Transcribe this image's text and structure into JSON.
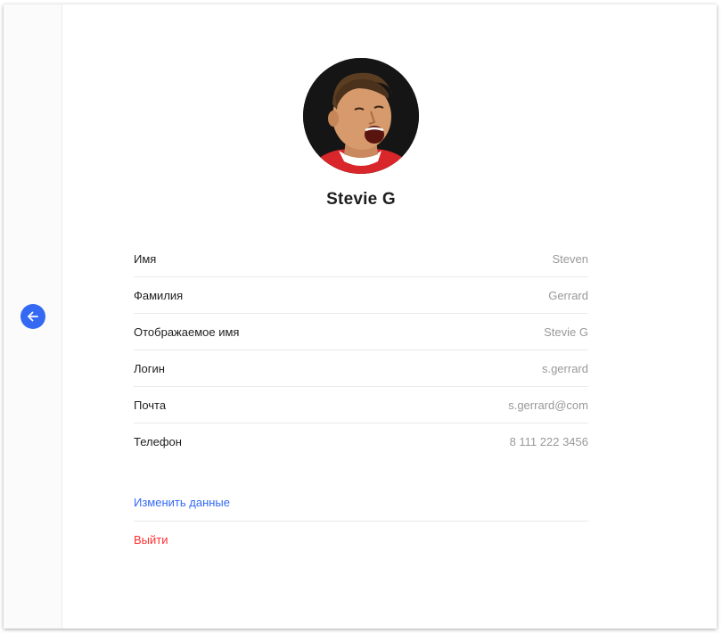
{
  "navigation": {
    "back_icon": "arrow-left-icon",
    "accent_color": "#3369f3"
  },
  "profile": {
    "avatar_icon": "user-avatar-photo",
    "display_name": "Stevie G",
    "fields": [
      {
        "label": "Имя",
        "value": "Steven"
      },
      {
        "label": "Фамилия",
        "value": "Gerrard"
      },
      {
        "label": "Отображаемое имя",
        "value": "Stevie G"
      },
      {
        "label": "Логин",
        "value": "s.gerrard"
      },
      {
        "label": "Почта",
        "value": "s.gerrard@com"
      },
      {
        "label": "Телефон",
        "value": "8 111 222 3456"
      }
    ]
  },
  "actions": {
    "edit_label": "Изменить данные",
    "edit_color": "#3369f3",
    "logout_label": "Выйти",
    "logout_color": "#ff2f2f"
  }
}
